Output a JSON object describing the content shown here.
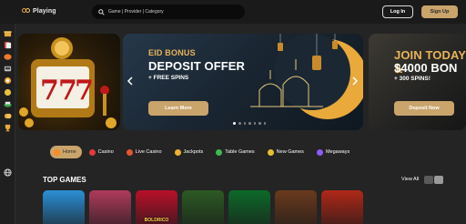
{
  "header": {
    "logo_text": "Playing",
    "search_placeholder": "Game | Provider | Category",
    "login_label": "Log In",
    "signup_label": "Sign Up"
  },
  "sidebar": {
    "icons": [
      "gift-icon",
      "cards-icon",
      "bonus-icon",
      "slots-icon",
      "chip-icon",
      "jackpot-icon",
      "table-icon",
      "coins-icon",
      "trophy-icon",
      "globe-icon"
    ]
  },
  "banners": {
    "center": {
      "small": "EID BONUS",
      "big": "DEPOSIT OFFER",
      "sub": "+ FREE SPINS",
      "button": "Learn More"
    },
    "right": {
      "big_line1": "JOIN TODAY &",
      "big_line2": "$4000 BON",
      "sub": "+ 300 SPINS!",
      "button": "Deposit Now"
    },
    "dots_count": 7,
    "active_dot": 0
  },
  "categories": [
    {
      "label": "Home",
      "active": true,
      "icon": "home-icon",
      "color": "#ff8a1f"
    },
    {
      "label": "Casino",
      "active": false,
      "icon": "casino-icon",
      "color": "#e23a3a"
    },
    {
      "label": "Live Casino",
      "active": false,
      "icon": "live-casino-icon",
      "color": "#e8542f"
    },
    {
      "label": "Jackpots",
      "active": false,
      "icon": "jackpots-icon",
      "color": "#f0b429"
    },
    {
      "label": "Table Games",
      "active": false,
      "icon": "table-games-icon",
      "color": "#3fb950"
    },
    {
      "label": "New Games",
      "active": false,
      "icon": "new-games-icon",
      "color": "#e8c02f"
    },
    {
      "label": "Megaways",
      "active": false,
      "icon": "megaways-icon",
      "color": "#8b5cf6"
    }
  ],
  "top_games": {
    "title": "TOP GAMES",
    "view_all": "View All",
    "tiles": [
      {
        "label": "",
        "color": "#2b8fd6"
      },
      {
        "label": "",
        "color": "#b03a5c"
      },
      {
        "label": "BOLDRICO",
        "color": "#b8102a"
      },
      {
        "label": "",
        "color": "#2c5a24"
      },
      {
        "label": "",
        "color": "#0d6a2a"
      },
      {
        "label": "",
        "color": "#6a3a1c"
      },
      {
        "label": "",
        "color": "#b02818"
      }
    ]
  }
}
